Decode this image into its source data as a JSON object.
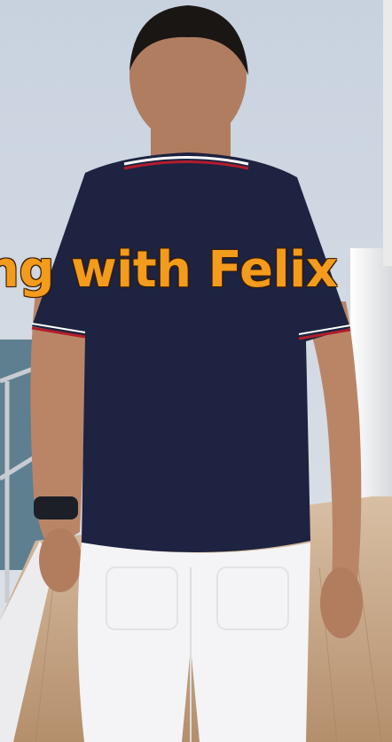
{
  "caption": {
    "text": "ng with Felix"
  },
  "palette": {
    "sky": "#cdd6e1",
    "sea": "#5d7f90",
    "shirt": "#1d2340",
    "pants": "#f4f4f6",
    "skin": "#b98366",
    "deck": "#c9a98a",
    "hull": "#e7e7ea",
    "caption": "#f39b1c"
  }
}
